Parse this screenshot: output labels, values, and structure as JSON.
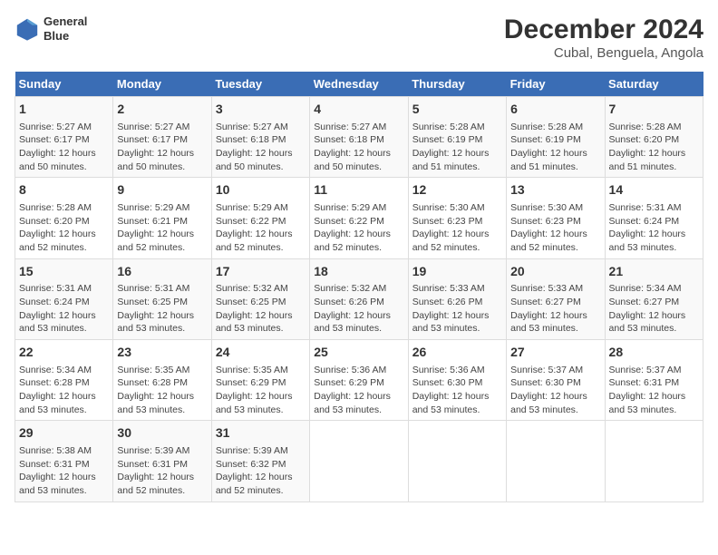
{
  "header": {
    "logo_line1": "General",
    "logo_line2": "Blue",
    "title": "December 2024",
    "subtitle": "Cubal, Benguela, Angola"
  },
  "columns": [
    "Sunday",
    "Monday",
    "Tuesday",
    "Wednesday",
    "Thursday",
    "Friday",
    "Saturday"
  ],
  "weeks": [
    [
      {
        "day": "1",
        "lines": [
          "Sunrise: 5:27 AM",
          "Sunset: 6:17 PM",
          "Daylight: 12 hours",
          "and 50 minutes."
        ]
      },
      {
        "day": "2",
        "lines": [
          "Sunrise: 5:27 AM",
          "Sunset: 6:17 PM",
          "Daylight: 12 hours",
          "and 50 minutes."
        ]
      },
      {
        "day": "3",
        "lines": [
          "Sunrise: 5:27 AM",
          "Sunset: 6:18 PM",
          "Daylight: 12 hours",
          "and 50 minutes."
        ]
      },
      {
        "day": "4",
        "lines": [
          "Sunrise: 5:27 AM",
          "Sunset: 6:18 PM",
          "Daylight: 12 hours",
          "and 50 minutes."
        ]
      },
      {
        "day": "5",
        "lines": [
          "Sunrise: 5:28 AM",
          "Sunset: 6:19 PM",
          "Daylight: 12 hours",
          "and 51 minutes."
        ]
      },
      {
        "day": "6",
        "lines": [
          "Sunrise: 5:28 AM",
          "Sunset: 6:19 PM",
          "Daylight: 12 hours",
          "and 51 minutes."
        ]
      },
      {
        "day": "7",
        "lines": [
          "Sunrise: 5:28 AM",
          "Sunset: 6:20 PM",
          "Daylight: 12 hours",
          "and 51 minutes."
        ]
      }
    ],
    [
      {
        "day": "8",
        "lines": [
          "Sunrise: 5:28 AM",
          "Sunset: 6:20 PM",
          "Daylight: 12 hours",
          "and 52 minutes."
        ]
      },
      {
        "day": "9",
        "lines": [
          "Sunrise: 5:29 AM",
          "Sunset: 6:21 PM",
          "Daylight: 12 hours",
          "and 52 minutes."
        ]
      },
      {
        "day": "10",
        "lines": [
          "Sunrise: 5:29 AM",
          "Sunset: 6:22 PM",
          "Daylight: 12 hours",
          "and 52 minutes."
        ]
      },
      {
        "day": "11",
        "lines": [
          "Sunrise: 5:29 AM",
          "Sunset: 6:22 PM",
          "Daylight: 12 hours",
          "and 52 minutes."
        ]
      },
      {
        "day": "12",
        "lines": [
          "Sunrise: 5:30 AM",
          "Sunset: 6:23 PM",
          "Daylight: 12 hours",
          "and 52 minutes."
        ]
      },
      {
        "day": "13",
        "lines": [
          "Sunrise: 5:30 AM",
          "Sunset: 6:23 PM",
          "Daylight: 12 hours",
          "and 52 minutes."
        ]
      },
      {
        "day": "14",
        "lines": [
          "Sunrise: 5:31 AM",
          "Sunset: 6:24 PM",
          "Daylight: 12 hours",
          "and 53 minutes."
        ]
      }
    ],
    [
      {
        "day": "15",
        "lines": [
          "Sunrise: 5:31 AM",
          "Sunset: 6:24 PM",
          "Daylight: 12 hours",
          "and 53 minutes."
        ]
      },
      {
        "day": "16",
        "lines": [
          "Sunrise: 5:31 AM",
          "Sunset: 6:25 PM",
          "Daylight: 12 hours",
          "and 53 minutes."
        ]
      },
      {
        "day": "17",
        "lines": [
          "Sunrise: 5:32 AM",
          "Sunset: 6:25 PM",
          "Daylight: 12 hours",
          "and 53 minutes."
        ]
      },
      {
        "day": "18",
        "lines": [
          "Sunrise: 5:32 AM",
          "Sunset: 6:26 PM",
          "Daylight: 12 hours",
          "and 53 minutes."
        ]
      },
      {
        "day": "19",
        "lines": [
          "Sunrise: 5:33 AM",
          "Sunset: 6:26 PM",
          "Daylight: 12 hours",
          "and 53 minutes."
        ]
      },
      {
        "day": "20",
        "lines": [
          "Sunrise: 5:33 AM",
          "Sunset: 6:27 PM",
          "Daylight: 12 hours",
          "and 53 minutes."
        ]
      },
      {
        "day": "21",
        "lines": [
          "Sunrise: 5:34 AM",
          "Sunset: 6:27 PM",
          "Daylight: 12 hours",
          "and 53 minutes."
        ]
      }
    ],
    [
      {
        "day": "22",
        "lines": [
          "Sunrise: 5:34 AM",
          "Sunset: 6:28 PM",
          "Daylight: 12 hours",
          "and 53 minutes."
        ]
      },
      {
        "day": "23",
        "lines": [
          "Sunrise: 5:35 AM",
          "Sunset: 6:28 PM",
          "Daylight: 12 hours",
          "and 53 minutes."
        ]
      },
      {
        "day": "24",
        "lines": [
          "Sunrise: 5:35 AM",
          "Sunset: 6:29 PM",
          "Daylight: 12 hours",
          "and 53 minutes."
        ]
      },
      {
        "day": "25",
        "lines": [
          "Sunrise: 5:36 AM",
          "Sunset: 6:29 PM",
          "Daylight: 12 hours",
          "and 53 minutes."
        ]
      },
      {
        "day": "26",
        "lines": [
          "Sunrise: 5:36 AM",
          "Sunset: 6:30 PM",
          "Daylight: 12 hours",
          "and 53 minutes."
        ]
      },
      {
        "day": "27",
        "lines": [
          "Sunrise: 5:37 AM",
          "Sunset: 6:30 PM",
          "Daylight: 12 hours",
          "and 53 minutes."
        ]
      },
      {
        "day": "28",
        "lines": [
          "Sunrise: 5:37 AM",
          "Sunset: 6:31 PM",
          "Daylight: 12 hours",
          "and 53 minutes."
        ]
      }
    ],
    [
      {
        "day": "29",
        "lines": [
          "Sunrise: 5:38 AM",
          "Sunset: 6:31 PM",
          "Daylight: 12 hours",
          "and 53 minutes."
        ]
      },
      {
        "day": "30",
        "lines": [
          "Sunrise: 5:39 AM",
          "Sunset: 6:31 PM",
          "Daylight: 12 hours",
          "and 52 minutes."
        ]
      },
      {
        "day": "31",
        "lines": [
          "Sunrise: 5:39 AM",
          "Sunset: 6:32 PM",
          "Daylight: 12 hours",
          "and 52 minutes."
        ]
      },
      null,
      null,
      null,
      null
    ]
  ]
}
